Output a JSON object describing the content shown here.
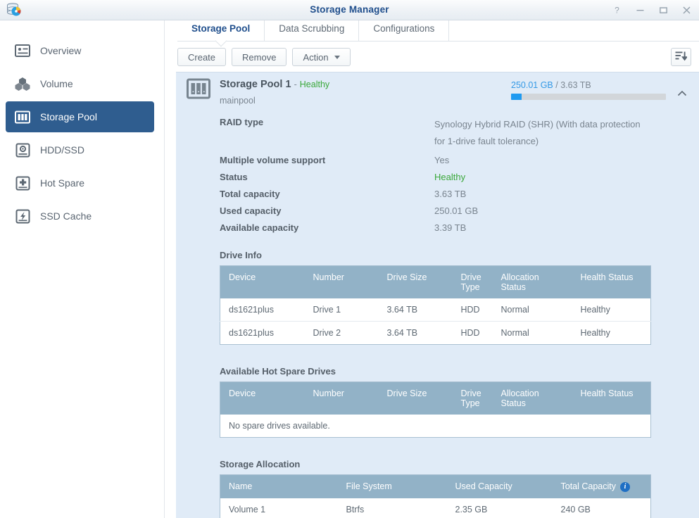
{
  "window": {
    "title": "Storage Manager",
    "app_icon": "storage-manager-icon",
    "controls": [
      {
        "name": "help-button",
        "glyph": "?"
      },
      {
        "name": "minimize-button",
        "glyph": "minimize"
      },
      {
        "name": "maximize-button",
        "glyph": "maximize"
      },
      {
        "name": "close-button",
        "glyph": "close"
      }
    ]
  },
  "sidebar": {
    "items": [
      {
        "label": "Overview",
        "icon": "overview-icon",
        "active": false
      },
      {
        "label": "Volume",
        "icon": "volume-icon",
        "active": false
      },
      {
        "label": "Storage Pool",
        "icon": "storage-pool-icon",
        "active": true
      },
      {
        "label": "HDD/SSD",
        "icon": "hdd-ssd-icon",
        "active": false
      },
      {
        "label": "Hot Spare",
        "icon": "hot-spare-icon",
        "active": false
      },
      {
        "label": "SSD Cache",
        "icon": "ssd-cache-icon",
        "active": false
      }
    ]
  },
  "tabs": [
    {
      "label": "Storage Pool",
      "active": true
    },
    {
      "label": "Data Scrubbing",
      "active": false
    },
    {
      "label": "Configurations",
      "active": false
    }
  ],
  "toolbar": {
    "create_label": "Create",
    "remove_label": "Remove",
    "action_label": "Action",
    "sort_icon": "sort-descending-icon"
  },
  "pool": {
    "name": "Storage Pool 1",
    "separator": "-",
    "status_label": "Healthy",
    "subtitle": "mainpool",
    "capacity_used": "250.01 GB",
    "capacity_separator": "/",
    "capacity_total": "3.63 TB",
    "capacity_percent": 7,
    "bay_icon": "drive-bay-icon",
    "collapse_icon": "chevron-up-icon",
    "info": [
      {
        "label": "RAID type",
        "value": "Synology Hybrid RAID (SHR) (With data protection for 1-drive fault tolerance)",
        "green": false,
        "multiline": true
      },
      {
        "label": "Multiple volume support",
        "value": "Yes",
        "green": false,
        "multiline": false
      },
      {
        "label": "Status",
        "value": "Healthy",
        "green": true,
        "multiline": false
      },
      {
        "label": "Total capacity",
        "value": "3.63 TB",
        "green": false,
        "multiline": false
      },
      {
        "label": "Used capacity",
        "value": "250.01 GB",
        "green": false,
        "multiline": false
      },
      {
        "label": "Available capacity",
        "value": "3.39 TB",
        "green": false,
        "multiline": false
      }
    ]
  },
  "drive_info": {
    "title": "Drive Info",
    "columns": [
      "Device",
      "Number",
      "Drive Size",
      "Drive Type",
      "Allocation Status",
      "Health Status"
    ],
    "rows": [
      [
        "ds1621plus",
        "Drive 1",
        "3.64 TB",
        "HDD",
        "Normal",
        "Healthy"
      ],
      [
        "ds1621plus",
        "Drive 2",
        "3.64 TB",
        "HDD",
        "Normal",
        "Healthy"
      ]
    ]
  },
  "hot_spare": {
    "title": "Available Hot Spare Drives",
    "columns": [
      "Device",
      "Number",
      "Drive Size",
      "Drive Type",
      "Allocation Status",
      "Health Status"
    ],
    "empty_message": "No spare drives available."
  },
  "storage_allocation": {
    "title": "Storage Allocation",
    "columns": [
      "Name",
      "File System",
      "Used Capacity",
      "Total Capacity"
    ],
    "info_icon": "info-icon",
    "rows": [
      [
        "Volume 1",
        "Btrfs",
        "2.35 GB",
        "240 GB"
      ]
    ]
  },
  "colors": {
    "accent_blue": "#2f5d8f",
    "title_blue": "#1f4e8c",
    "healthy_green": "#3aa83a",
    "panel_bg": "#e0ebf7",
    "table_header": "#92b2c7",
    "progress_fill": "#1f9af0"
  }
}
